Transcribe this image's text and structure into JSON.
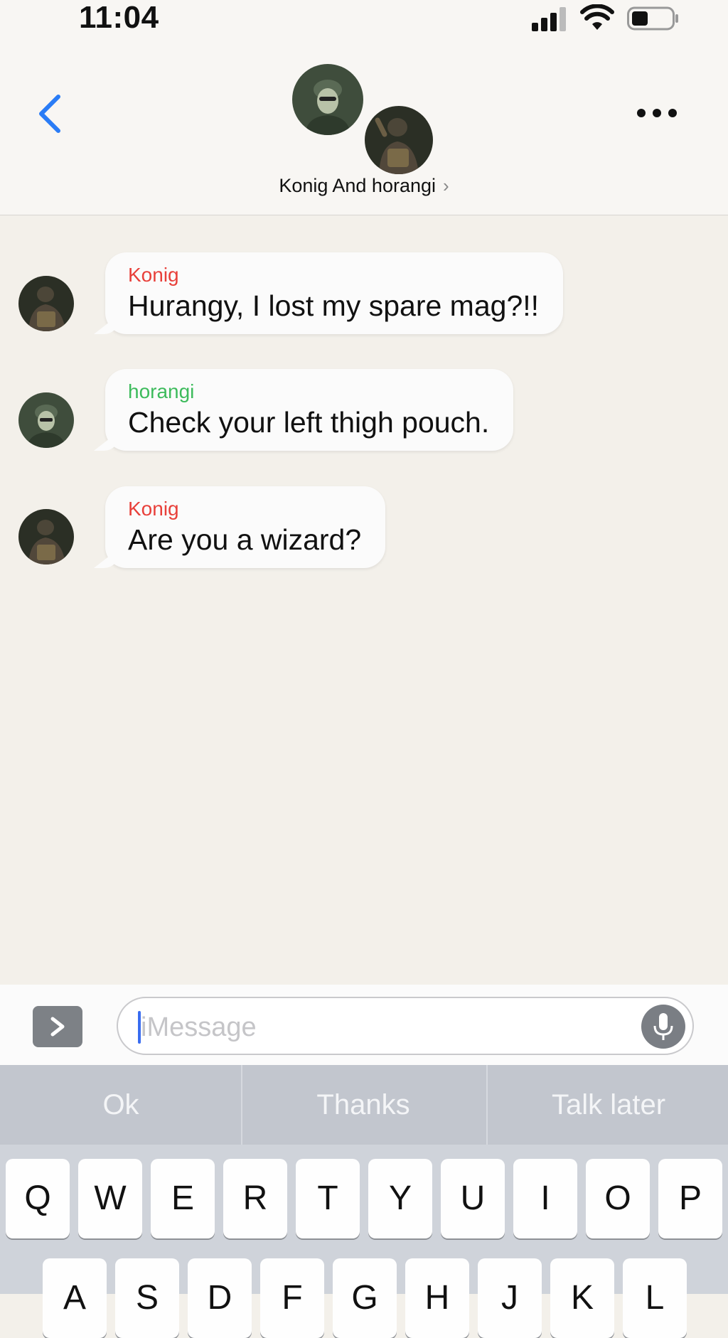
{
  "status_bar": {
    "time": "11:04"
  },
  "header": {
    "title": "Konig And horangi",
    "chevron": "›"
  },
  "messages": [
    {
      "sender": "Konig",
      "sender_color": "#e8403a",
      "text": "Hurangy, I lost my spare mag?!!"
    },
    {
      "sender": "horangi",
      "sender_color": "#3dbb5c",
      "text": "Check your left thigh pouch."
    },
    {
      "sender": "Konig",
      "sender_color": "#e8403a",
      "text": "Are you a wizard?"
    }
  ],
  "input": {
    "placeholder": "iMessage"
  },
  "keyboard": {
    "predictions": [
      "Ok",
      "Thanks",
      "Talk later"
    ],
    "row1": [
      "Q",
      "W",
      "E",
      "R",
      "T",
      "Y",
      "U",
      "I",
      "O",
      "P"
    ],
    "row2": [
      "A",
      "S",
      "D",
      "F",
      "G",
      "H",
      "J",
      "K",
      "L"
    ]
  },
  "colors": {
    "accent_blue": "#2a7cf6",
    "konig_red": "#e8403a",
    "horangi_green": "#3dbb5c"
  },
  "icons": [
    "signal-icon",
    "wifi-icon",
    "battery-icon",
    "back-chevron-icon",
    "more-icon",
    "apps-icon",
    "mic-icon"
  ]
}
